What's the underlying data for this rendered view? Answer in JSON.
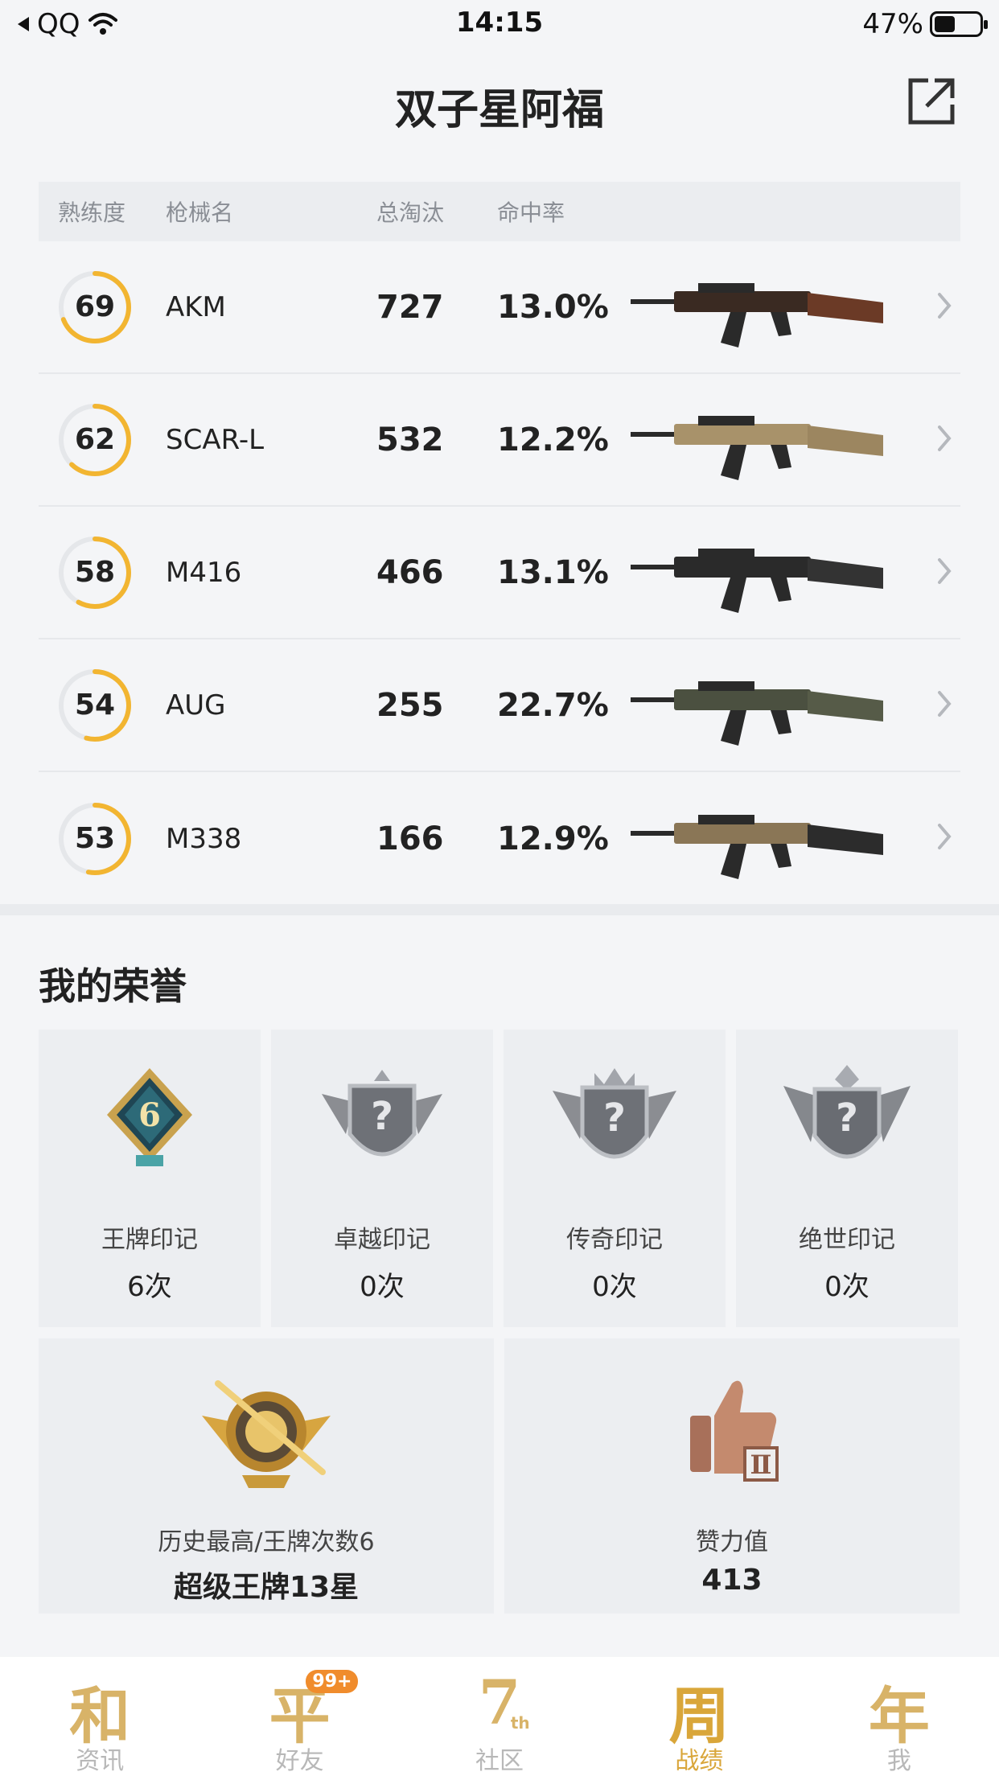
{
  "status_bar": {
    "back_app": "QQ",
    "time": "14:15",
    "battery": "47%",
    "battery_level": 0.47
  },
  "header": {
    "title": "双子星阿福"
  },
  "weapon_table": {
    "headers": {
      "proficiency": "熟练度",
      "name": "枪械名",
      "kills": "总淘汰",
      "accuracy": "命中率"
    },
    "rows": [
      {
        "proficiency": "69",
        "progress": 0.69,
        "name": "AKM",
        "kills": "727",
        "accuracy": "13.0%",
        "gun_color": "#3a2a22",
        "stock_color": "#6b3a26"
      },
      {
        "proficiency": "62",
        "progress": 0.62,
        "name": "SCAR-L",
        "kills": "532",
        "accuracy": "12.2%",
        "gun_color": "#a8926a",
        "stock_color": "#9c8660"
      },
      {
        "proficiency": "58",
        "progress": 0.58,
        "name": "M416",
        "kills": "466",
        "accuracy": "13.1%",
        "gun_color": "#2a2a2a",
        "stock_color": "#333333"
      },
      {
        "proficiency": "54",
        "progress": 0.54,
        "name": "AUG",
        "kills": "255",
        "accuracy": "22.7%",
        "gun_color": "#4b5040",
        "stock_color": "#565b48"
      },
      {
        "proficiency": "53",
        "progress": 0.53,
        "name": "M338",
        "kills": "166",
        "accuracy": "12.9%",
        "gun_color": "#8a7656",
        "stock_color": "#2c2c2c"
      }
    ]
  },
  "honor": {
    "title": "我的荣誉",
    "marks": [
      {
        "label": "王牌印记",
        "count": "6次",
        "icon": "ace-mark-badge-icon",
        "badge_number": "6"
      },
      {
        "label": "卓越印记",
        "count": "0次",
        "icon": "excellent-mark-badge-icon"
      },
      {
        "label": "传奇印记",
        "count": "0次",
        "icon": "legend-mark-badge-icon"
      },
      {
        "label": "绝世印记",
        "count": "0次",
        "icon": "peerless-mark-badge-icon"
      }
    ],
    "highest": {
      "label": "历史最高/王牌次数6",
      "value": "超级王牌13星",
      "icon": "super-ace-rank-icon"
    },
    "likes": {
      "label": "赞力值",
      "value": "413",
      "icon": "thumbs-up-icon"
    }
  },
  "tabbar": {
    "tabs": [
      {
        "glyph": "和",
        "label": "资讯",
        "active": false
      },
      {
        "glyph": "平",
        "label": "好友",
        "active": false,
        "badge": "99+"
      },
      {
        "glyph": "7",
        "label": "社区",
        "active": false,
        "sup": "th"
      },
      {
        "glyph": "周",
        "label": "战绩",
        "active": true
      },
      {
        "glyph": "年",
        "label": "我",
        "active": false
      }
    ]
  },
  "colors": {
    "ring_progress": "#f2b531",
    "ring_track": "#e5e7ea",
    "accent_gold": "#d9a63a",
    "badge_orange": "#f08c2c"
  }
}
